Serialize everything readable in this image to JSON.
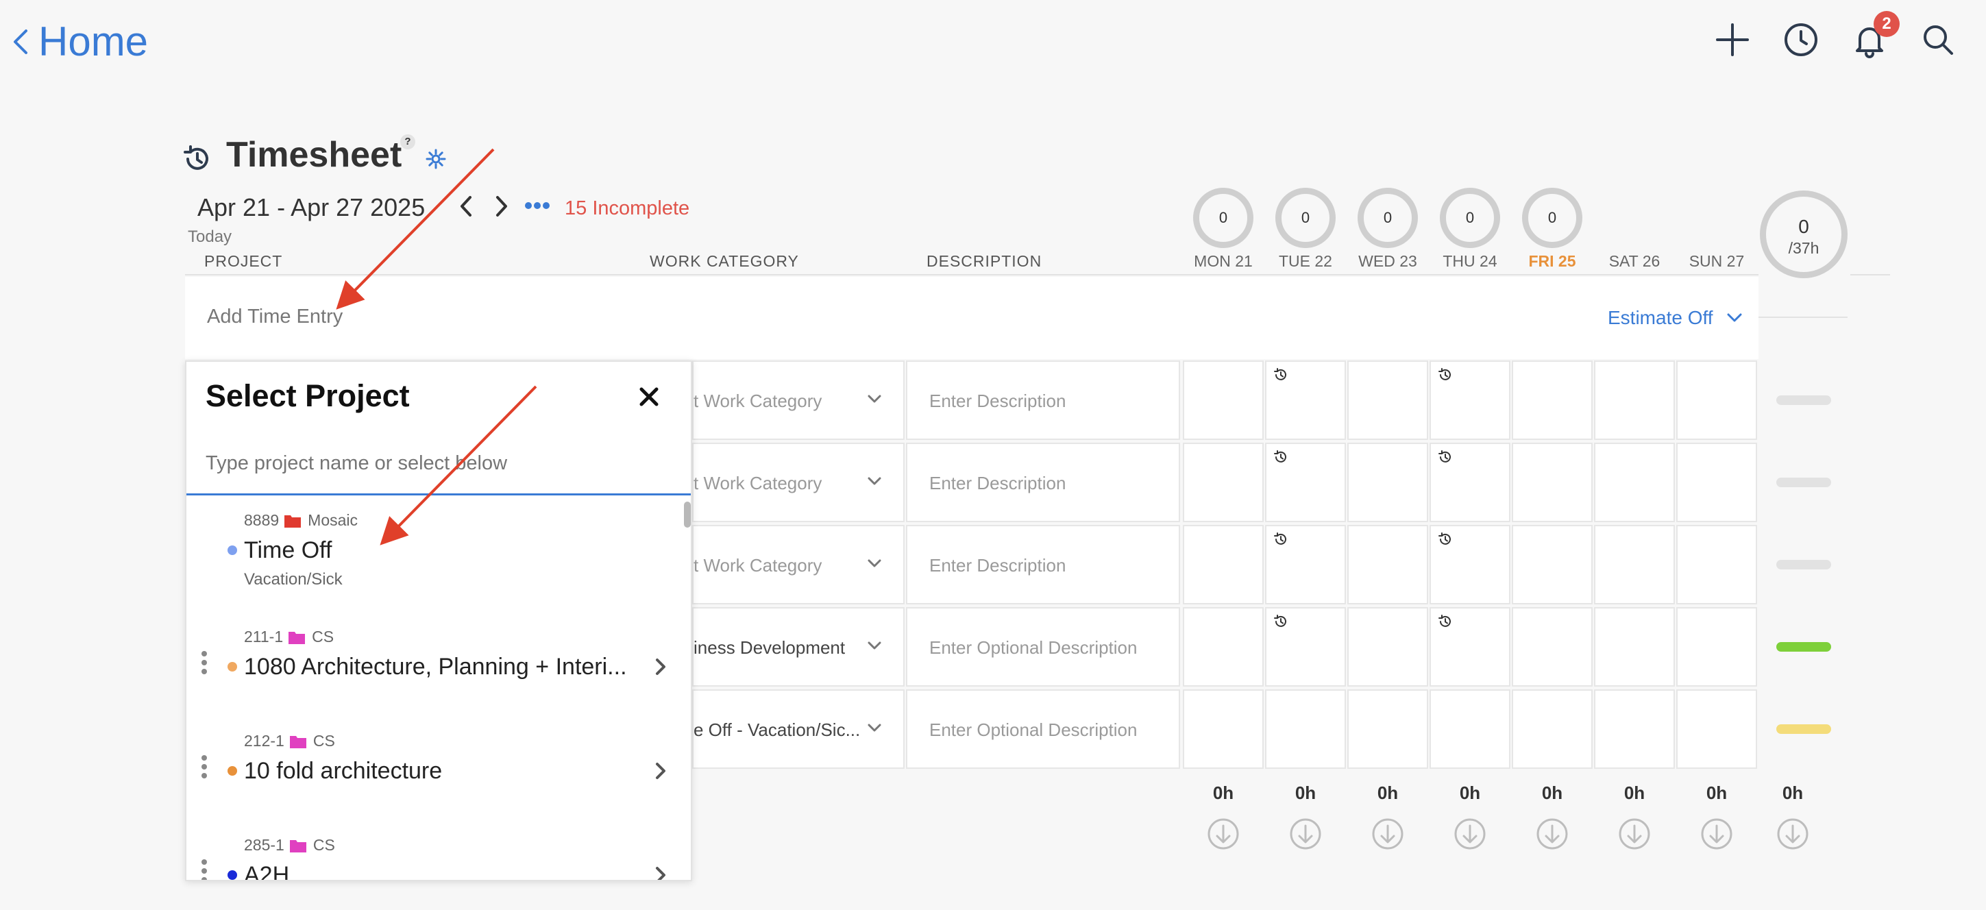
{
  "header": {
    "back_label": "Home",
    "notifications_count": "2",
    "icons": [
      "plus-icon",
      "clock-icon",
      "bell-icon",
      "search-icon"
    ]
  },
  "timesheet": {
    "title": "Timesheet",
    "help": "?",
    "date_range": "Apr 21 - Apr 27 2025",
    "incomplete": "15 Incomplete",
    "today": "Today",
    "columns": {
      "project": "PROJECT",
      "work_category": "WORK CATEGORY",
      "description": "DESCRIPTION"
    },
    "days": [
      {
        "label": "MON 21",
        "value": "0",
        "total": "0h"
      },
      {
        "label": "TUE 22",
        "value": "0",
        "total": "0h"
      },
      {
        "label": "WED 23",
        "value": "0",
        "total": "0h"
      },
      {
        "label": "THU 24",
        "value": "0",
        "total": "0h"
      },
      {
        "label": "FRI 25",
        "value": "0",
        "total": "0h"
      },
      {
        "label": "SAT 26",
        "total": "0h"
      },
      {
        "label": "SUN 27",
        "total": "0h"
      }
    ],
    "week_total": {
      "value": "0",
      "capacity": "/37h",
      "total": "0h"
    },
    "add_entry": "Add Time Entry",
    "estimate": "Estimate Off",
    "rows": [
      {
        "category": "t Work Category",
        "description": "Enter Description",
        "bar_color": "#e2e2e2"
      },
      {
        "category": "t Work Category",
        "description": "Enter Description",
        "bar_color": "#e2e2e2"
      },
      {
        "category": "t Work Category",
        "description": "Enter Description",
        "bar_color": "#e2e2e2"
      },
      {
        "category": "iness Development",
        "description": "Enter Optional Description",
        "bar_color": "#7ed03a"
      },
      {
        "category": "e Off - Vacation/Sic...",
        "description": "Enter Optional Description",
        "bar_color": "#f4dc7a"
      }
    ]
  },
  "select_project": {
    "title": "Select Project",
    "placeholder": "Type project name or select below",
    "items": [
      {
        "number": "8889",
        "client": "Mosaic",
        "name": "Time Off",
        "sub": "Vacation/Sick",
        "dot_color": "#7ea0ef",
        "folder_color": "#e03a2f"
      },
      {
        "number": "211-1",
        "client": "CS",
        "name": "1080 Architecture, Planning + Interi...",
        "dot_color": "#f0a860",
        "folder_color": "#e040c0"
      },
      {
        "number": "212-1",
        "client": "CS",
        "name": "10 fold architecture",
        "dot_color": "#e8913a",
        "folder_color": "#e040c0"
      },
      {
        "number": "285-1",
        "client": "CS",
        "name": "A2H",
        "dot_color": "#1a2bd8",
        "folder_color": "#e040c0"
      }
    ]
  },
  "colors": {
    "accent": "#3a7bd5",
    "danger": "#e0534a",
    "today": "#e8913a",
    "annotation": "#e0402a"
  }
}
